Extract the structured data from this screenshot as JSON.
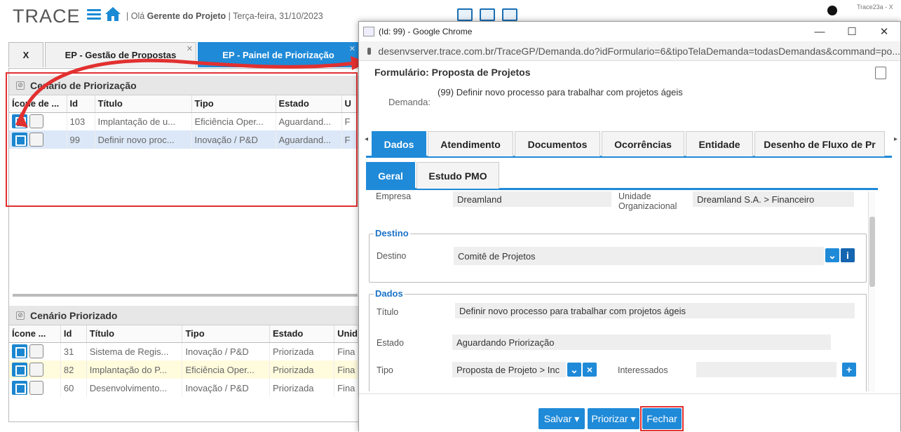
{
  "app": {
    "logo": "TRACE",
    "greeting_prefix": "| Olá",
    "user_role": "Gerente do Projeto",
    "date": "| Terça-feira, 31/10/2023",
    "user_label": "Trace23a - X"
  },
  "bg_tabs": [
    {
      "label": "X"
    },
    {
      "label": "EP - Gestão de Propostas"
    },
    {
      "label": "EP - Painel de Priorização"
    }
  ],
  "cenario_priorizacao": {
    "title": "Cenário de Priorização",
    "columns": [
      "Ícone de ...",
      "Id",
      "Título",
      "Tipo",
      "Estado",
      "U"
    ],
    "rows": [
      {
        "id": "103",
        "titulo": "Implantação de u...",
        "tipo": "Eficiência Oper...",
        "estado": "Aguardand...",
        "u": "F"
      },
      {
        "id": "99",
        "titulo": "Definir novo proc...",
        "tipo": "Inovação / P&D",
        "estado": "Aguardand...",
        "u": "F"
      }
    ]
  },
  "cenario_priorizado": {
    "title": "Cenário Priorizado",
    "columns": [
      "Ícone ...",
      "Id",
      "Título",
      "Tipo",
      "Estado",
      "Unid"
    ],
    "rows": [
      {
        "id": "31",
        "titulo": "Sistema de Regis...",
        "tipo": "Inovação / P&D",
        "estado": "Priorizada",
        "u": "Fina"
      },
      {
        "id": "82",
        "titulo": "Implantação do P...",
        "tipo": "Eficiência Oper...",
        "estado": "Priorizada",
        "u": "Fina"
      },
      {
        "id": "60",
        "titulo": "Desenvolvimento...",
        "tipo": "Inovação / P&D",
        "estado": "Priorizada",
        "u": "Fina"
      }
    ]
  },
  "window": {
    "title": "(Id: 99) - Google Chrome",
    "url": "desenvserver.trace.com.br/TraceGP/Demanda.do?idFormulario=6&tipoTelaDemanda=todasDemandas&command=po...",
    "controls": {
      "minimize": "—",
      "maximize": "☐",
      "close": "✕"
    }
  },
  "form": {
    "title": "Formulário: Proposta de Projetos",
    "demanda_label": "Demanda:",
    "demanda_value": "(99) Definir novo processo para trabalhar com projetos ágeis",
    "tabs": [
      "Dados",
      "Atendimento",
      "Documentos",
      "Ocorrências",
      "Entidade",
      "Desenho de Fluxo de Pr"
    ],
    "subtabs": [
      "Geral",
      "Estudo PMO"
    ],
    "empresa_label": "Empresa",
    "empresa_value": "Dreamland",
    "unidade_label": "Unidade Organizacional",
    "unidade_value": "Dreamland S.A. > Financeiro",
    "destino_legend": "Destino",
    "destino_label": "Destino",
    "destino_value": "Comitê de Projetos",
    "dados_legend": "Dados",
    "titulo_label": "Título",
    "titulo_value": "Definir novo processo para trabalhar com projetos ágeis",
    "estado_label": "Estado",
    "estado_value": "Aguardando Priorização",
    "tipo_label": "Tipo",
    "tipo_value": "Proposta de Projeto > Inc",
    "interessados_label": "Interessados"
  },
  "footer": {
    "salvar": "Salvar ▾",
    "priorizar": "Priorizar ▾",
    "fechar": "Fechar"
  },
  "colors": {
    "accent": "#1f8ad8",
    "highlight": "#e23030"
  }
}
